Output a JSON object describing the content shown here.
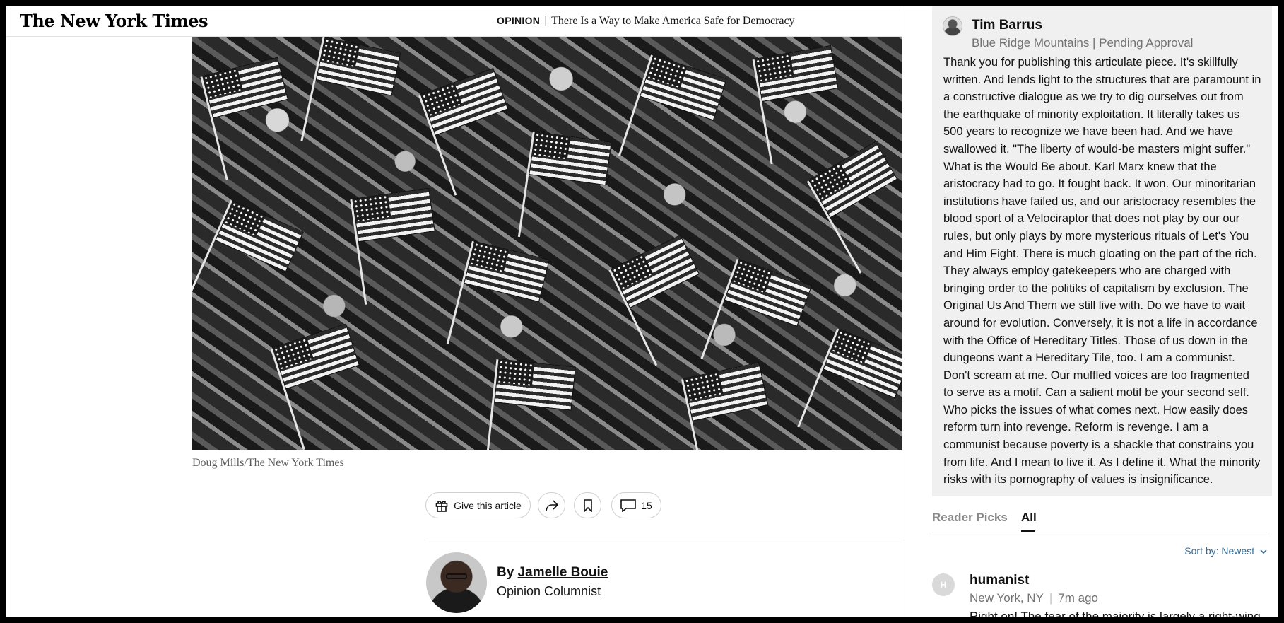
{
  "header": {
    "logo": "The New York Times",
    "section": "OPINION",
    "divider": "|",
    "headline": "There Is a Way to Make America Safe for Democracy"
  },
  "photo": {
    "credit": "Doug Mills/The New York Times"
  },
  "share_tools": {
    "gift_label": "Give this article",
    "comment_count": "15",
    "icons": {
      "gift": "gift-icon",
      "share": "share-icon",
      "save": "bookmark-icon",
      "comments": "comment-bubble-icon"
    }
  },
  "byline": {
    "prefix": "By ",
    "author": "Jamelle Bouie",
    "role": "Opinion Columnist"
  },
  "comments_panel": {
    "pending_comment": {
      "name": "Tim Barrus",
      "meta": "Blue Ridge Mountains | Pending Approval",
      "body": "Thank you for publishing this articulate piece. It's skillfully written. And lends light to the structures that are paramount in a constructive dialogue as we try to dig ourselves out from the earthquake of minority exploitation. It literally takes us 500 years to recognize we have been had. And we have swallowed it. \"The liberty of would-be masters might suffer.\" What is the Would Be about. Karl Marx knew that the aristocracy had to go. It fought back. It won. Our minoritarian institutions have failed us, and our aristocracy resembles the blood sport of a Velociraptor that does not play by our our rules, but only plays by more mysterious rituals of Let's You and Him Fight. There is much gloating on the part of the rich. They always employ gatekeepers who are charged with bringing order to the politiks of capitalism by exclusion. The Original Us And Them we still live with. Do we have to wait around for evolution. Conversely, it is not a life in accordance with the Office of Hereditary Titles. Those of us down in the dungeons want a Hereditary Tile, too. I am a communist. Don't scream at me. Our muffled voices are too fragmented to serve as a motif. Can a salient motif be your second self. Who picks the issues of what comes next. How easily does reform turn into revenge. Reform is revenge. I am a communist because poverty is a shackle that constrains you from life. And I mean to live it. As I define it. What the minority risks with its pornography of values is insignificance."
    },
    "tabs": {
      "reader_picks": "Reader Picks",
      "all": "All"
    },
    "sort_label": "Sort by: Newest",
    "comments": [
      {
        "initial": "H",
        "name": "humanist",
        "location": "New York, NY",
        "time": "7m ago",
        "snippet": "Right on! The fear of the majority is largely a right-wing"
      }
    ]
  },
  "colors": {
    "link_blue": "#326891",
    "muted_gray": "#727272",
    "pending_bg": "#f0f0f0"
  }
}
